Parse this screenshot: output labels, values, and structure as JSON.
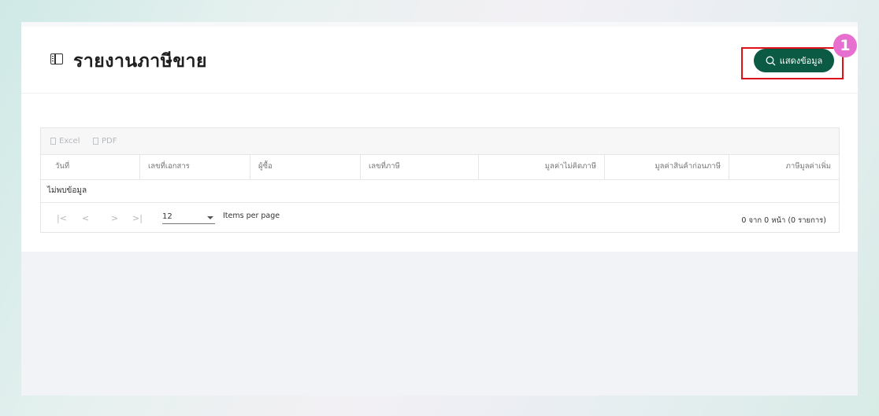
{
  "page": {
    "title": "รายงานภาษีขาย",
    "show_button_label": "แสดงข้อมูล",
    "step_badge": "1"
  },
  "toolbar": {
    "excel_label": "Excel",
    "pdf_label": "PDF"
  },
  "table": {
    "columns": [
      "วันที่",
      "เลขที่เอกสาร",
      "ผู้ซื้อ",
      "เลขที่ภาษี",
      "มูลค่าไม่คิดภาษี",
      "มูลค่าสินค้าก่อนภาษี",
      "ภาษีมูลค่าเพิ่ม"
    ],
    "empty_text": "ไม่พบข้อมูล"
  },
  "pager": {
    "first": "|<",
    "prev": "<",
    "next": ">",
    "last": ">|",
    "per_page_value": "12",
    "per_page_label": "Items per page",
    "info": "0 จาก 0 หน้า (0 รายการ)"
  },
  "colors": {
    "primary_button": "#0b5a43",
    "highlight": "#e0101a",
    "badge": "#e76fd0"
  }
}
